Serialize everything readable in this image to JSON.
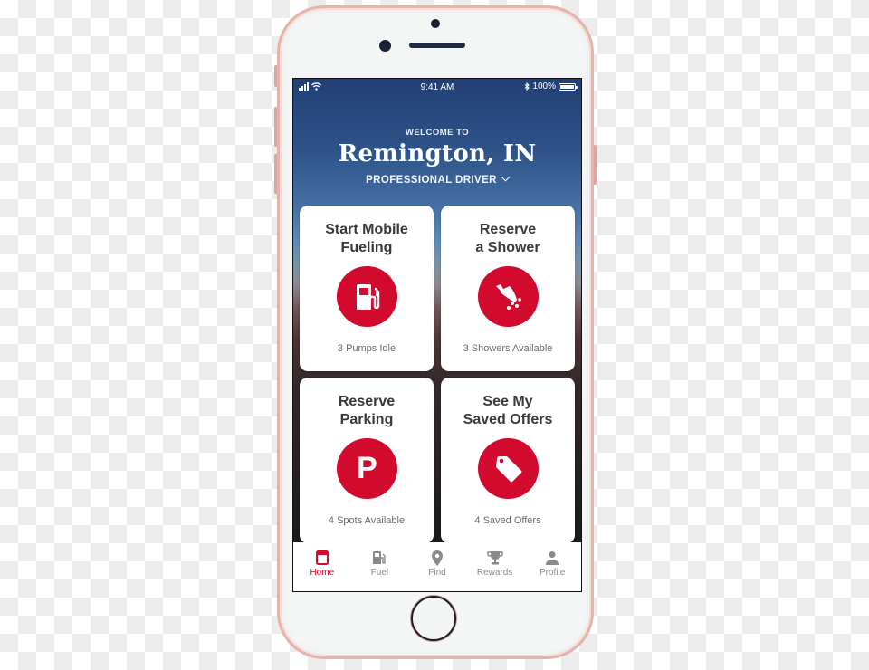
{
  "device": {
    "frame_color": "#e3b4ae",
    "body_color": "#f4f6f6"
  },
  "status_bar": {
    "time": "9:41 AM",
    "battery_percent": "100%",
    "battery_level": 1.0,
    "signal_icon": "cellular-signal-icon",
    "wifi_icon": "wifi-icon",
    "bluetooth_icon": "bluetooth-icon"
  },
  "header": {
    "welcome": "WELCOME TO",
    "location": "Remington, IN",
    "profile_type": "PROFESSIONAL DRIVER"
  },
  "colors": {
    "accent": "#d20a2e",
    "card_title": "#3a3a3a",
    "card_subtitle": "#6b6b6b",
    "nav_inactive": "#8a8a8a"
  },
  "cards": [
    {
      "title_line1": "Start Mobile",
      "title_line2": "Fueling",
      "icon": "fuel-pump-icon",
      "subtitle": "3 Pumps Idle"
    },
    {
      "title_line1": "Reserve",
      "title_line2": "a Shower",
      "icon": "shower-icon",
      "subtitle": "3 Showers Available"
    },
    {
      "title_line1": "Reserve",
      "title_line2": "Parking",
      "icon": "parking-icon",
      "icon_text": "P",
      "subtitle": "4 Spots Available"
    },
    {
      "title_line1": "See My",
      "title_line2": "Saved Offers",
      "icon": "tag-icon",
      "subtitle": "4 Saved Offers"
    }
  ],
  "bottom_nav": {
    "active": "Home",
    "items": [
      {
        "label": "Home",
        "icon": "home-icon"
      },
      {
        "label": "Fuel",
        "icon": "fuel-icon"
      },
      {
        "label": "Find",
        "icon": "location-pin-icon"
      },
      {
        "label": "Rewards",
        "icon": "trophy-icon"
      },
      {
        "label": "Profile",
        "icon": "person-icon"
      }
    ]
  }
}
